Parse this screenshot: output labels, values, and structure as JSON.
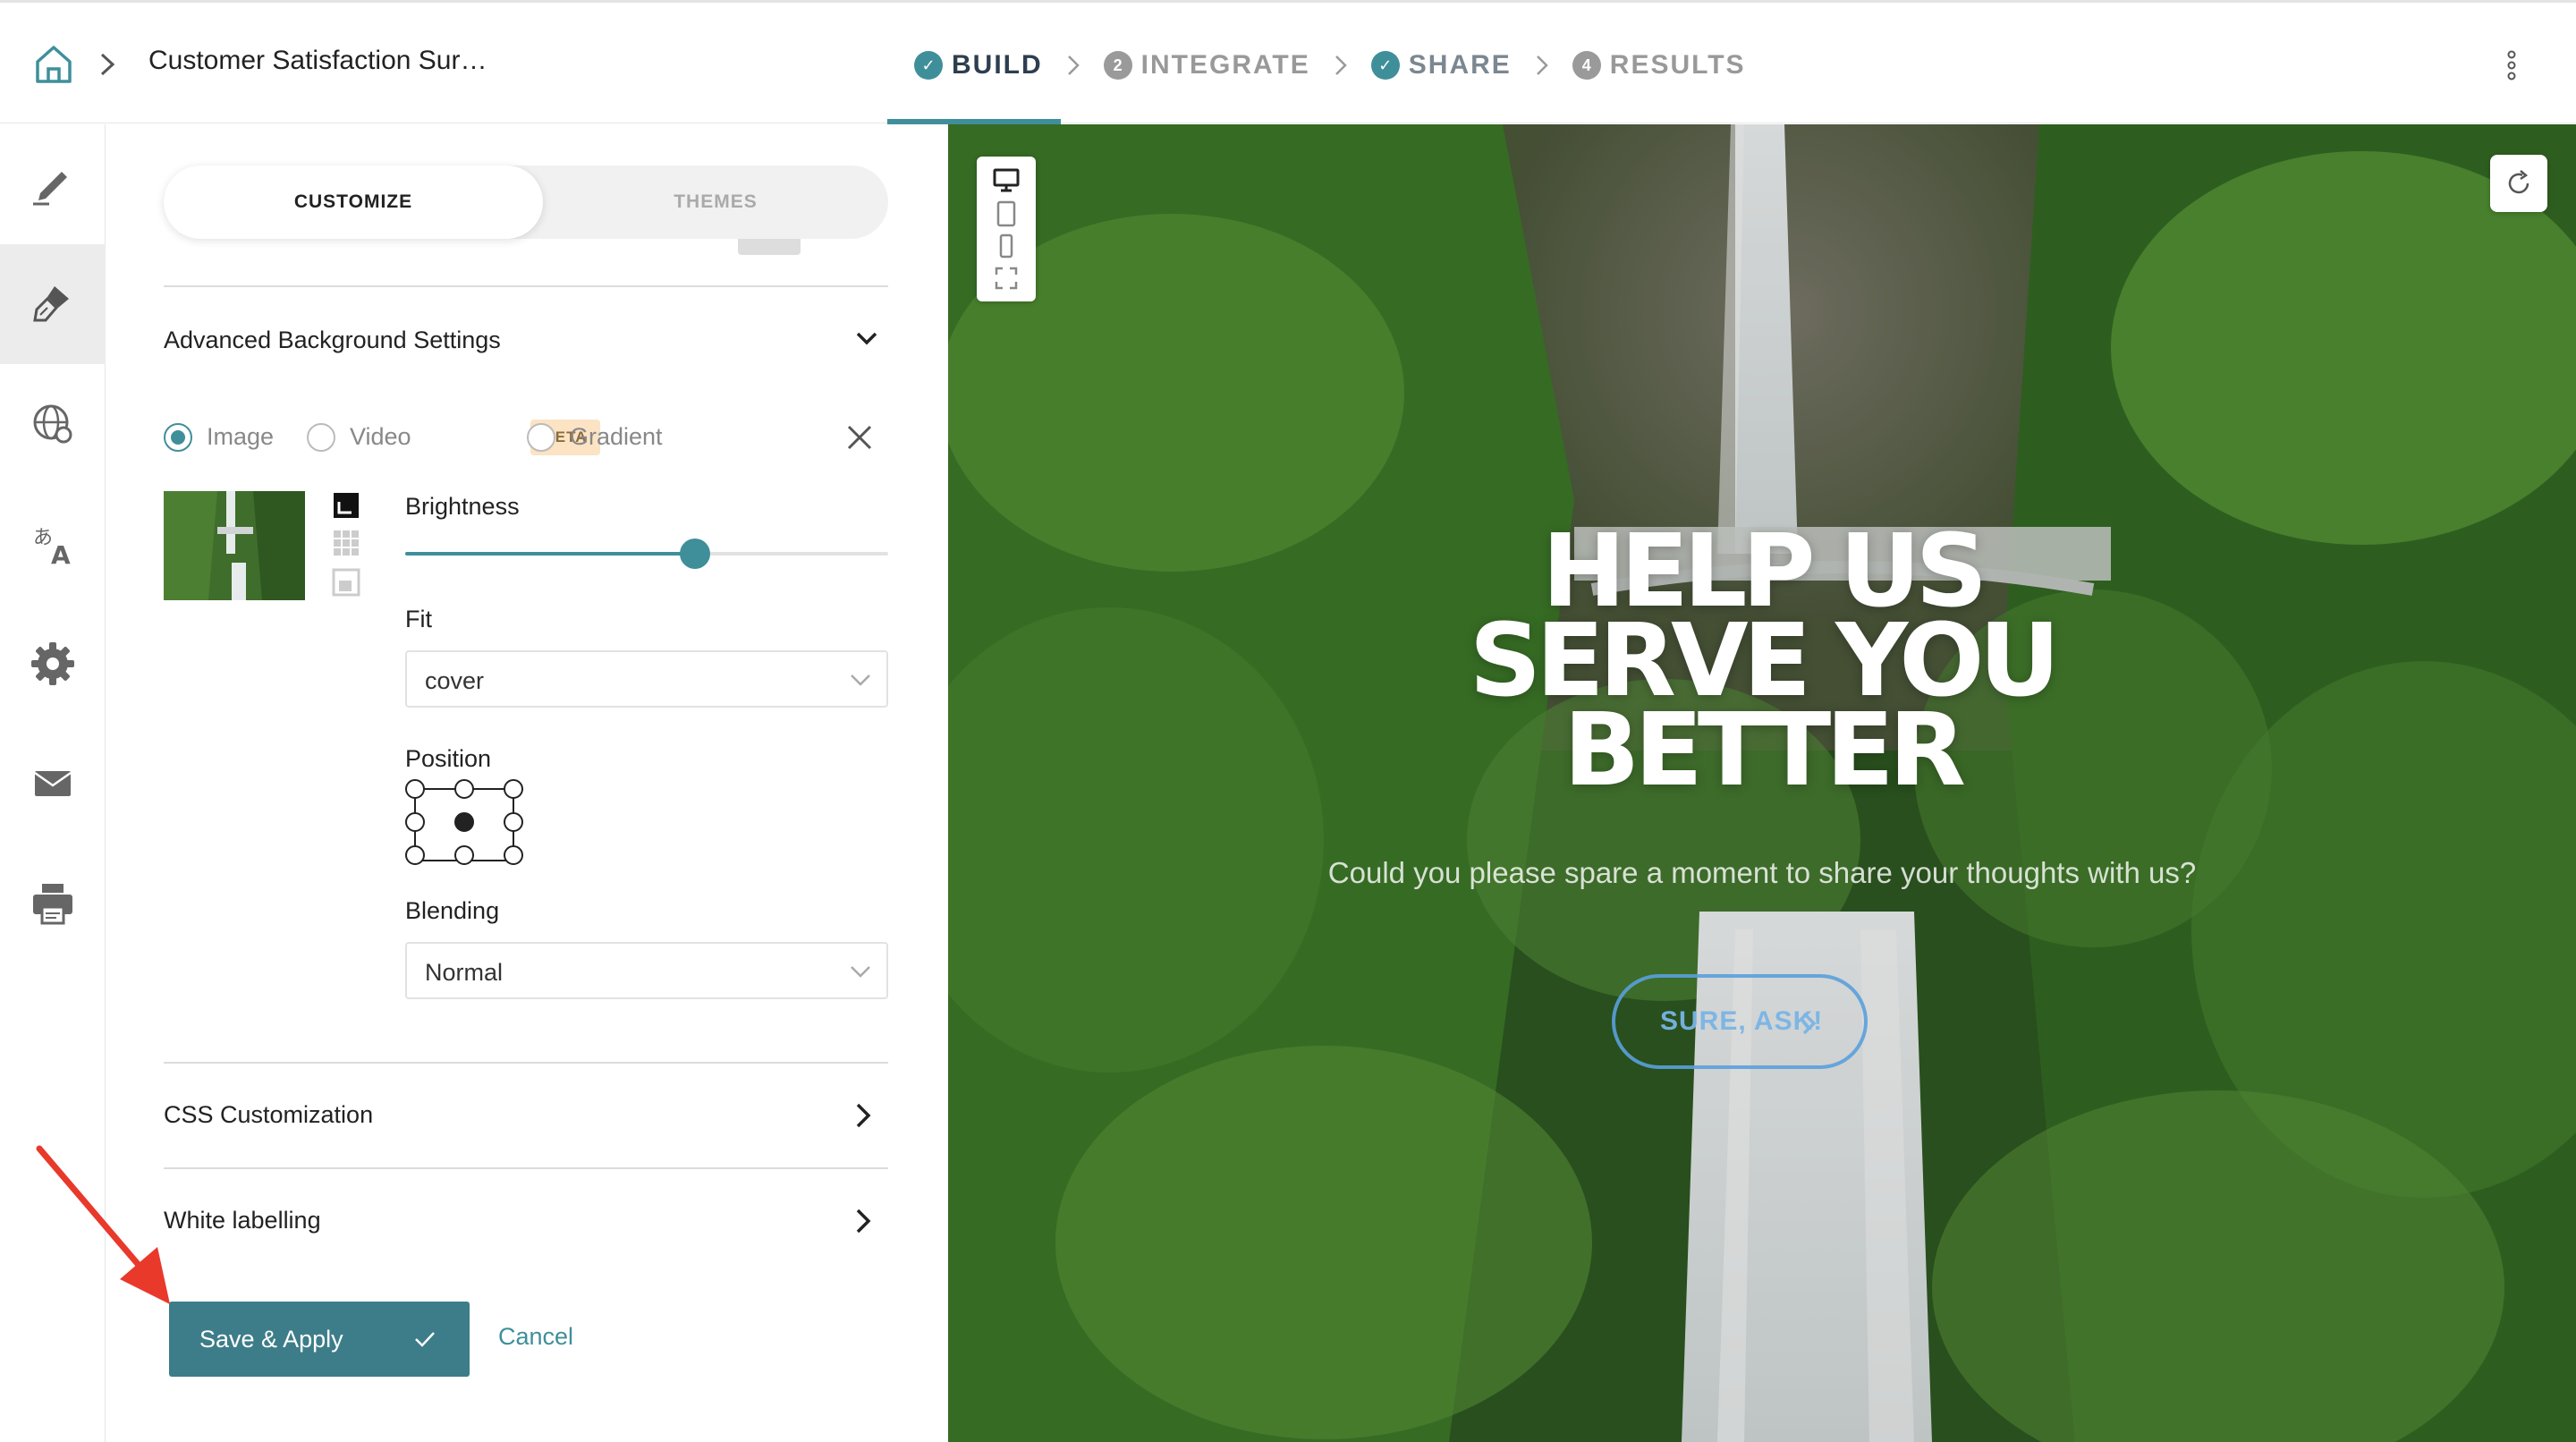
{
  "header": {
    "breadcrumb_title": "Customer Satisfaction Sur…",
    "steps": [
      {
        "label": "BUILD",
        "marker": "✓",
        "state": "active"
      },
      {
        "label": "INTEGRATE",
        "marker": "2",
        "state": "todo"
      },
      {
        "label": "SHARE",
        "marker": "✓",
        "state": "done"
      },
      {
        "label": "RESULTS",
        "marker": "4",
        "state": "todo"
      }
    ]
  },
  "sidebar": {
    "items": [
      {
        "icon": "pencil-icon",
        "active": false
      },
      {
        "icon": "paint-brush-icon",
        "active": true
      },
      {
        "icon": "globe-icon",
        "active": false
      },
      {
        "icon": "translate-icon",
        "active": false
      },
      {
        "icon": "gear-icon",
        "active": false
      },
      {
        "icon": "envelope-icon",
        "active": false
      },
      {
        "icon": "printer-icon",
        "active": false
      }
    ]
  },
  "panel": {
    "tabs": {
      "customize": "CUSTOMIZE",
      "themes": "THEMES"
    },
    "advanced_bg_title": "Advanced Background Settings",
    "bg_type": {
      "image": "Image",
      "video": "Video",
      "beta": "BETA",
      "gradient": "Gradient",
      "selected": "Image"
    },
    "brightness": {
      "label": "Brightness",
      "value_fraction": 0.6
    },
    "fit": {
      "label": "Fit",
      "value": "cover"
    },
    "position": {
      "label": "Position",
      "selected": "center"
    },
    "blending": {
      "label": "Blending",
      "value": "Normal"
    },
    "css_title": "CSS Customization",
    "white_label_title": "White labelling",
    "save_label": "Save & Apply",
    "cancel_label": "Cancel"
  },
  "preview": {
    "title_lines": [
      "HELP US",
      "SERVE YOU",
      "BETTER"
    ],
    "subtitle": "Could you please spare a moment to share your thoughts with us?",
    "button_label": "SURE, ASK!"
  },
  "colors": {
    "accent": "#3f8f9a",
    "save_button": "#3d7d89",
    "annotation_arrow": "#e8392b"
  }
}
